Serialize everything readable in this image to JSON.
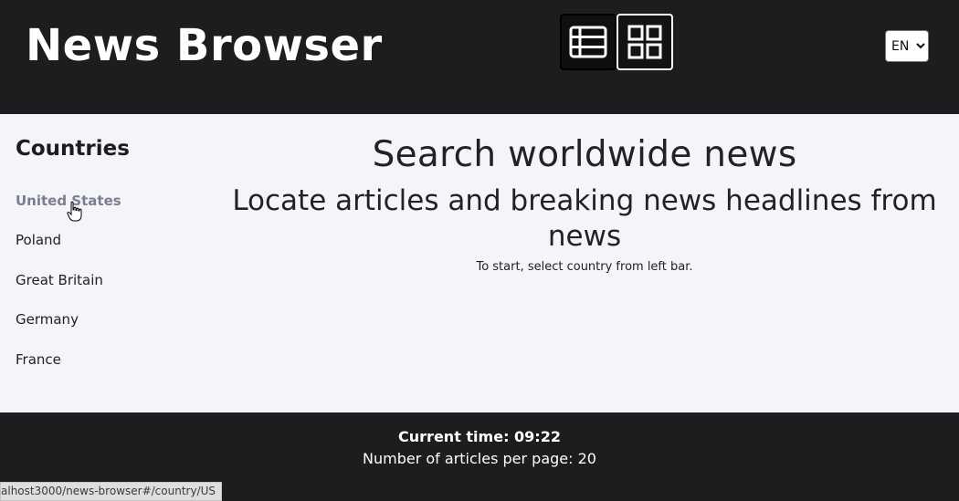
{
  "header": {
    "title": "News Browser",
    "language": "EN",
    "language_options": [
      "EN"
    ]
  },
  "sidebar": {
    "title": "Countries",
    "items": [
      {
        "label": "United States",
        "active": true
      },
      {
        "label": "Poland"
      },
      {
        "label": "Great Britain"
      },
      {
        "label": "Germany"
      },
      {
        "label": "France"
      }
    ]
  },
  "main": {
    "heading": "Search worldwide news",
    "subheading": "Locate articles and breaking news headlines from news",
    "hint": "To start, select country from left bar."
  },
  "footer": {
    "current_time_label": "Current time: 09:22",
    "articles_per_page_label": "Number of articles per page: 20"
  },
  "status_bar": {
    "url": "alhost3000/news-browser#/country/US"
  },
  "colors": {
    "header_bg": "#1d1d1f",
    "page_bg": "#f4f4f9",
    "active_country": "#7a7f8e"
  },
  "icons": {
    "list_view": "list-view-icon",
    "grid_view": "grid-view-icon",
    "cursor": "hand-cursor-icon"
  }
}
